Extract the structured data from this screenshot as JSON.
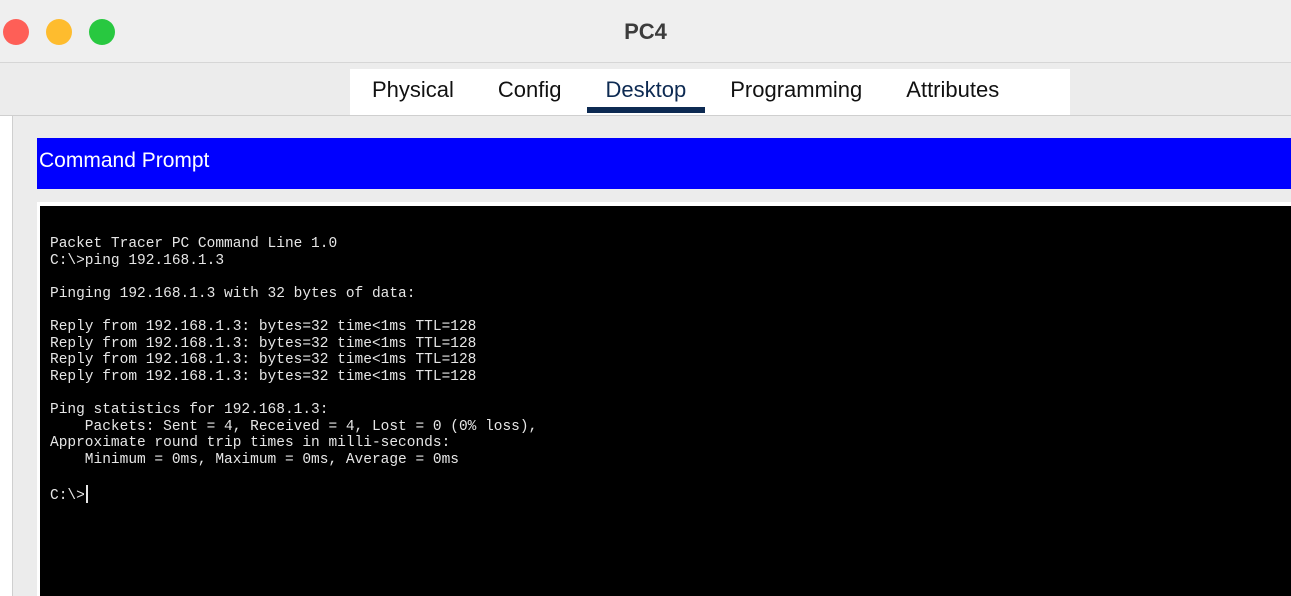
{
  "window": {
    "title": "PC4",
    "colors": {
      "close": "#fe5f57",
      "minimize": "#febc2e",
      "maximize": "#28c840"
    }
  },
  "tabs": [
    {
      "label": "Physical",
      "active": false
    },
    {
      "label": "Config",
      "active": false
    },
    {
      "label": "Desktop",
      "active": true
    },
    {
      "label": "Programming",
      "active": false
    },
    {
      "label": "Attributes",
      "active": false
    }
  ],
  "app": {
    "title": "Command Prompt",
    "header_color": "#0000ff"
  },
  "terminal": {
    "lines": [
      "Packet Tracer PC Command Line 1.0",
      "C:\\>ping 192.168.1.3",
      "",
      "Pinging 192.168.1.3 with 32 bytes of data:",
      "",
      "Reply from 192.168.1.3: bytes=32 time<1ms TTL=128",
      "Reply from 192.168.1.3: bytes=32 time<1ms TTL=128",
      "Reply from 192.168.1.3: bytes=32 time<1ms TTL=128",
      "Reply from 192.168.1.3: bytes=32 time<1ms TTL=128",
      "",
      "Ping statistics for 192.168.1.3:",
      "    Packets: Sent = 4, Received = 4, Lost = 0 (0% loss),",
      "Approximate round trip times in milli-seconds:",
      "    Minimum = 0ms, Maximum = 0ms, Average = 0ms",
      ""
    ],
    "prompt": "C:\\>"
  }
}
